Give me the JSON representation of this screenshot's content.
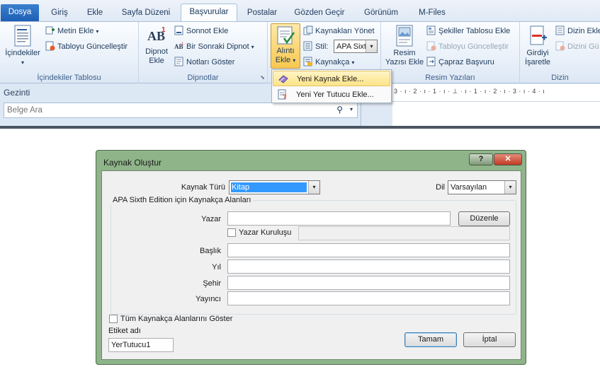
{
  "ribbon": {
    "tabs": [
      {
        "label": "Dosya"
      },
      {
        "label": "Giriş"
      },
      {
        "label": "Ekle"
      },
      {
        "label": "Sayfa Düzeni"
      },
      {
        "label": "Başvurular"
      },
      {
        "label": "Postalar"
      },
      {
        "label": "Gözden Geçir"
      },
      {
        "label": "Görünüm"
      },
      {
        "label": "M-Files"
      }
    ],
    "groups": {
      "toc": {
        "label": "İçindekiler Tablosu",
        "toc_button": "İçindekiler",
        "add_text": "Metin Ekle",
        "update_table": "Tabloyu Güncelleştir"
      },
      "footnotes": {
        "label": "Dipnotlar",
        "insert_footnote_1": "Dipnot",
        "insert_footnote_2": "Ekle",
        "insert_endnote": "Sonnot Ekle",
        "next_footnote": "Bir Sonraki Dipnot",
        "show_notes": "Notları Göster"
      },
      "citations": {
        "insert_citation_1": "Alıntı",
        "insert_citation_2": "Ekle",
        "manage_sources": "Kaynakları Yönet",
        "style_label": "Stil:",
        "style_value": "APA Sixth",
        "bibliography": "Kaynakça"
      },
      "captions": {
        "label": "Resim Yazıları",
        "insert_caption_1": "Resim",
        "insert_caption_2": "Yazısı Ekle",
        "table_of_figures": "Şekiller Tablosu Ekle",
        "update_table": "Tabloyu Güncelleştir",
        "cross_reference": "Çapraz Başvuru"
      },
      "index": {
        "label": "Dizin",
        "mark_entry_1": "Girdiyi",
        "mark_entry_2": "İşaretle",
        "insert_index": "Dizin Ekle",
        "update_index": "Dizini Gü"
      }
    },
    "citation_menu": {
      "items": [
        {
          "label": "Yeni Kaynak Ekle..."
        },
        {
          "label": "Yeni Yer Tutucu Ekle..."
        }
      ]
    }
  },
  "nav_pane": {
    "title": "Gezinti",
    "search_placeholder": "Belge Ara"
  },
  "ruler": {
    "text": "3 · ı · 2 · ı · 1 · ı · ⊥ · ı · 1 · ı · 2 · ı · 3 · ı · 4 · ı"
  },
  "dialog": {
    "title": "Kaynak Oluştur",
    "help_button": "?",
    "close_button": "✕",
    "source_type_label": "Kaynak Türü",
    "source_type_value": "Kitap",
    "language_label": "Dil",
    "language_value": "Varsayılan",
    "fields_legend": "APA Sixth Edition için Kaynakça Alanları",
    "fields": {
      "author_label": "Yazar",
      "author_value": "",
      "edit_button": "Düzenle",
      "corporate_author_label": "Yazar Kuruluşu",
      "corporate_author_checked": false,
      "title_label": "Başlık",
      "title_value": "",
      "year_label": "Yıl",
      "year_value": "",
      "city_label": "Şehir",
      "city_value": "",
      "publisher_label": "Yayıncı",
      "publisher_value": ""
    },
    "show_all_label": "Tüm Kaynakça Alanlarını Göster",
    "show_all_checked": false,
    "tag_label": "Etiket adı",
    "tag_value": "YerTutucu1",
    "ok_button": "Tamam",
    "cancel_button": "İptal"
  }
}
